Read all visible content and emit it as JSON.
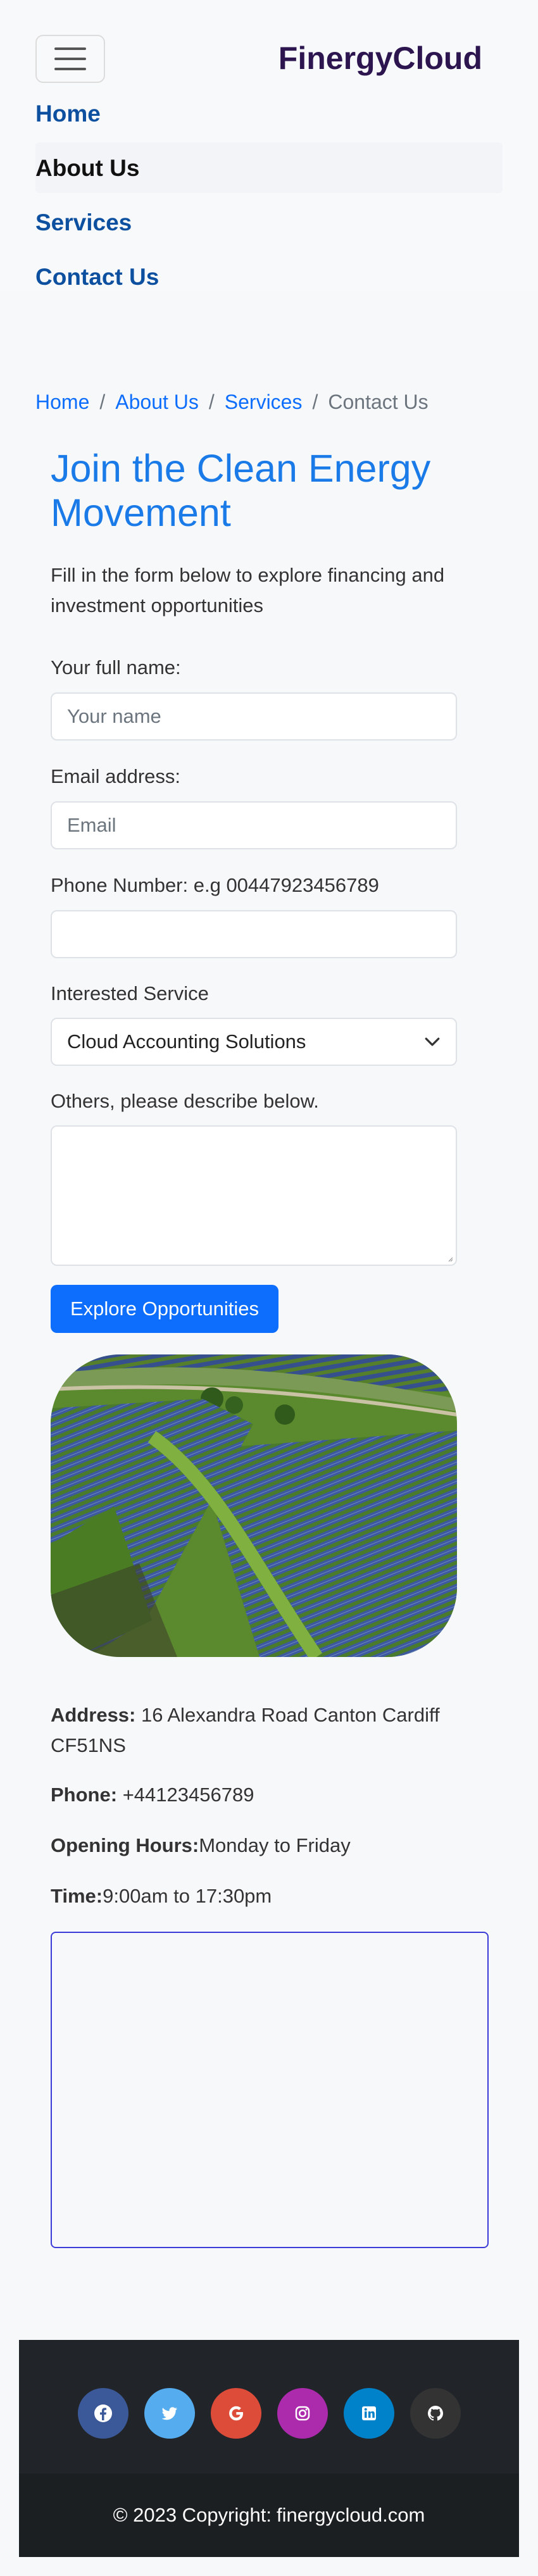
{
  "navbar": {
    "brand": "FinergyCloud",
    "links": [
      "Home",
      "About Us",
      "Services",
      "Contact Us"
    ]
  },
  "breadcrumb": [
    "Home",
    "About Us",
    "Services",
    "Contact Us"
  ],
  "form": {
    "title": "Join the Clean Energy Movement",
    "intro": "Fill in the form below to explore financing and investment opportunities",
    "name_label": "Your full name:",
    "name_placeholder": "Your name",
    "email_label": "Email address:",
    "email_placeholder": "Email",
    "phone_label": "Phone Number: e.g 00447923456789",
    "service_label": "Interested Service",
    "service_selected": "Cloud Accounting Solutions",
    "others_label": "Others, please describe below.",
    "submit_label": "Explore Opportunities"
  },
  "contact": {
    "address_label": "Address:",
    "address": "16 Alexandra Road Canton Cardiff CF51NS",
    "phone_label": "Phone:",
    "phone": "+44123456789",
    "hours_label": "Opening Hours:",
    "hours": "Monday to Friday",
    "time_label": "Time:",
    "time": "9:00am to 17:30pm"
  },
  "footer": {
    "socials": [
      "facebook-icon",
      "twitter-icon",
      "google-icon",
      "instagram-icon",
      "linkedin-icon",
      "github-icon"
    ],
    "social_colors": [
      "#3b5998",
      "#55acee",
      "#dd4b39",
      "#ac2bac",
      "#0082ca",
      "#333333"
    ],
    "copyright": "© 2023 Copyright:",
    "copyright_link": "finergycloud.com"
  },
  "colors": {
    "brand": "#2d1650",
    "link": "#0d50a0",
    "accent": "#0d6efd",
    "title": "#1a7be8",
    "footer_bg": "#212529"
  }
}
